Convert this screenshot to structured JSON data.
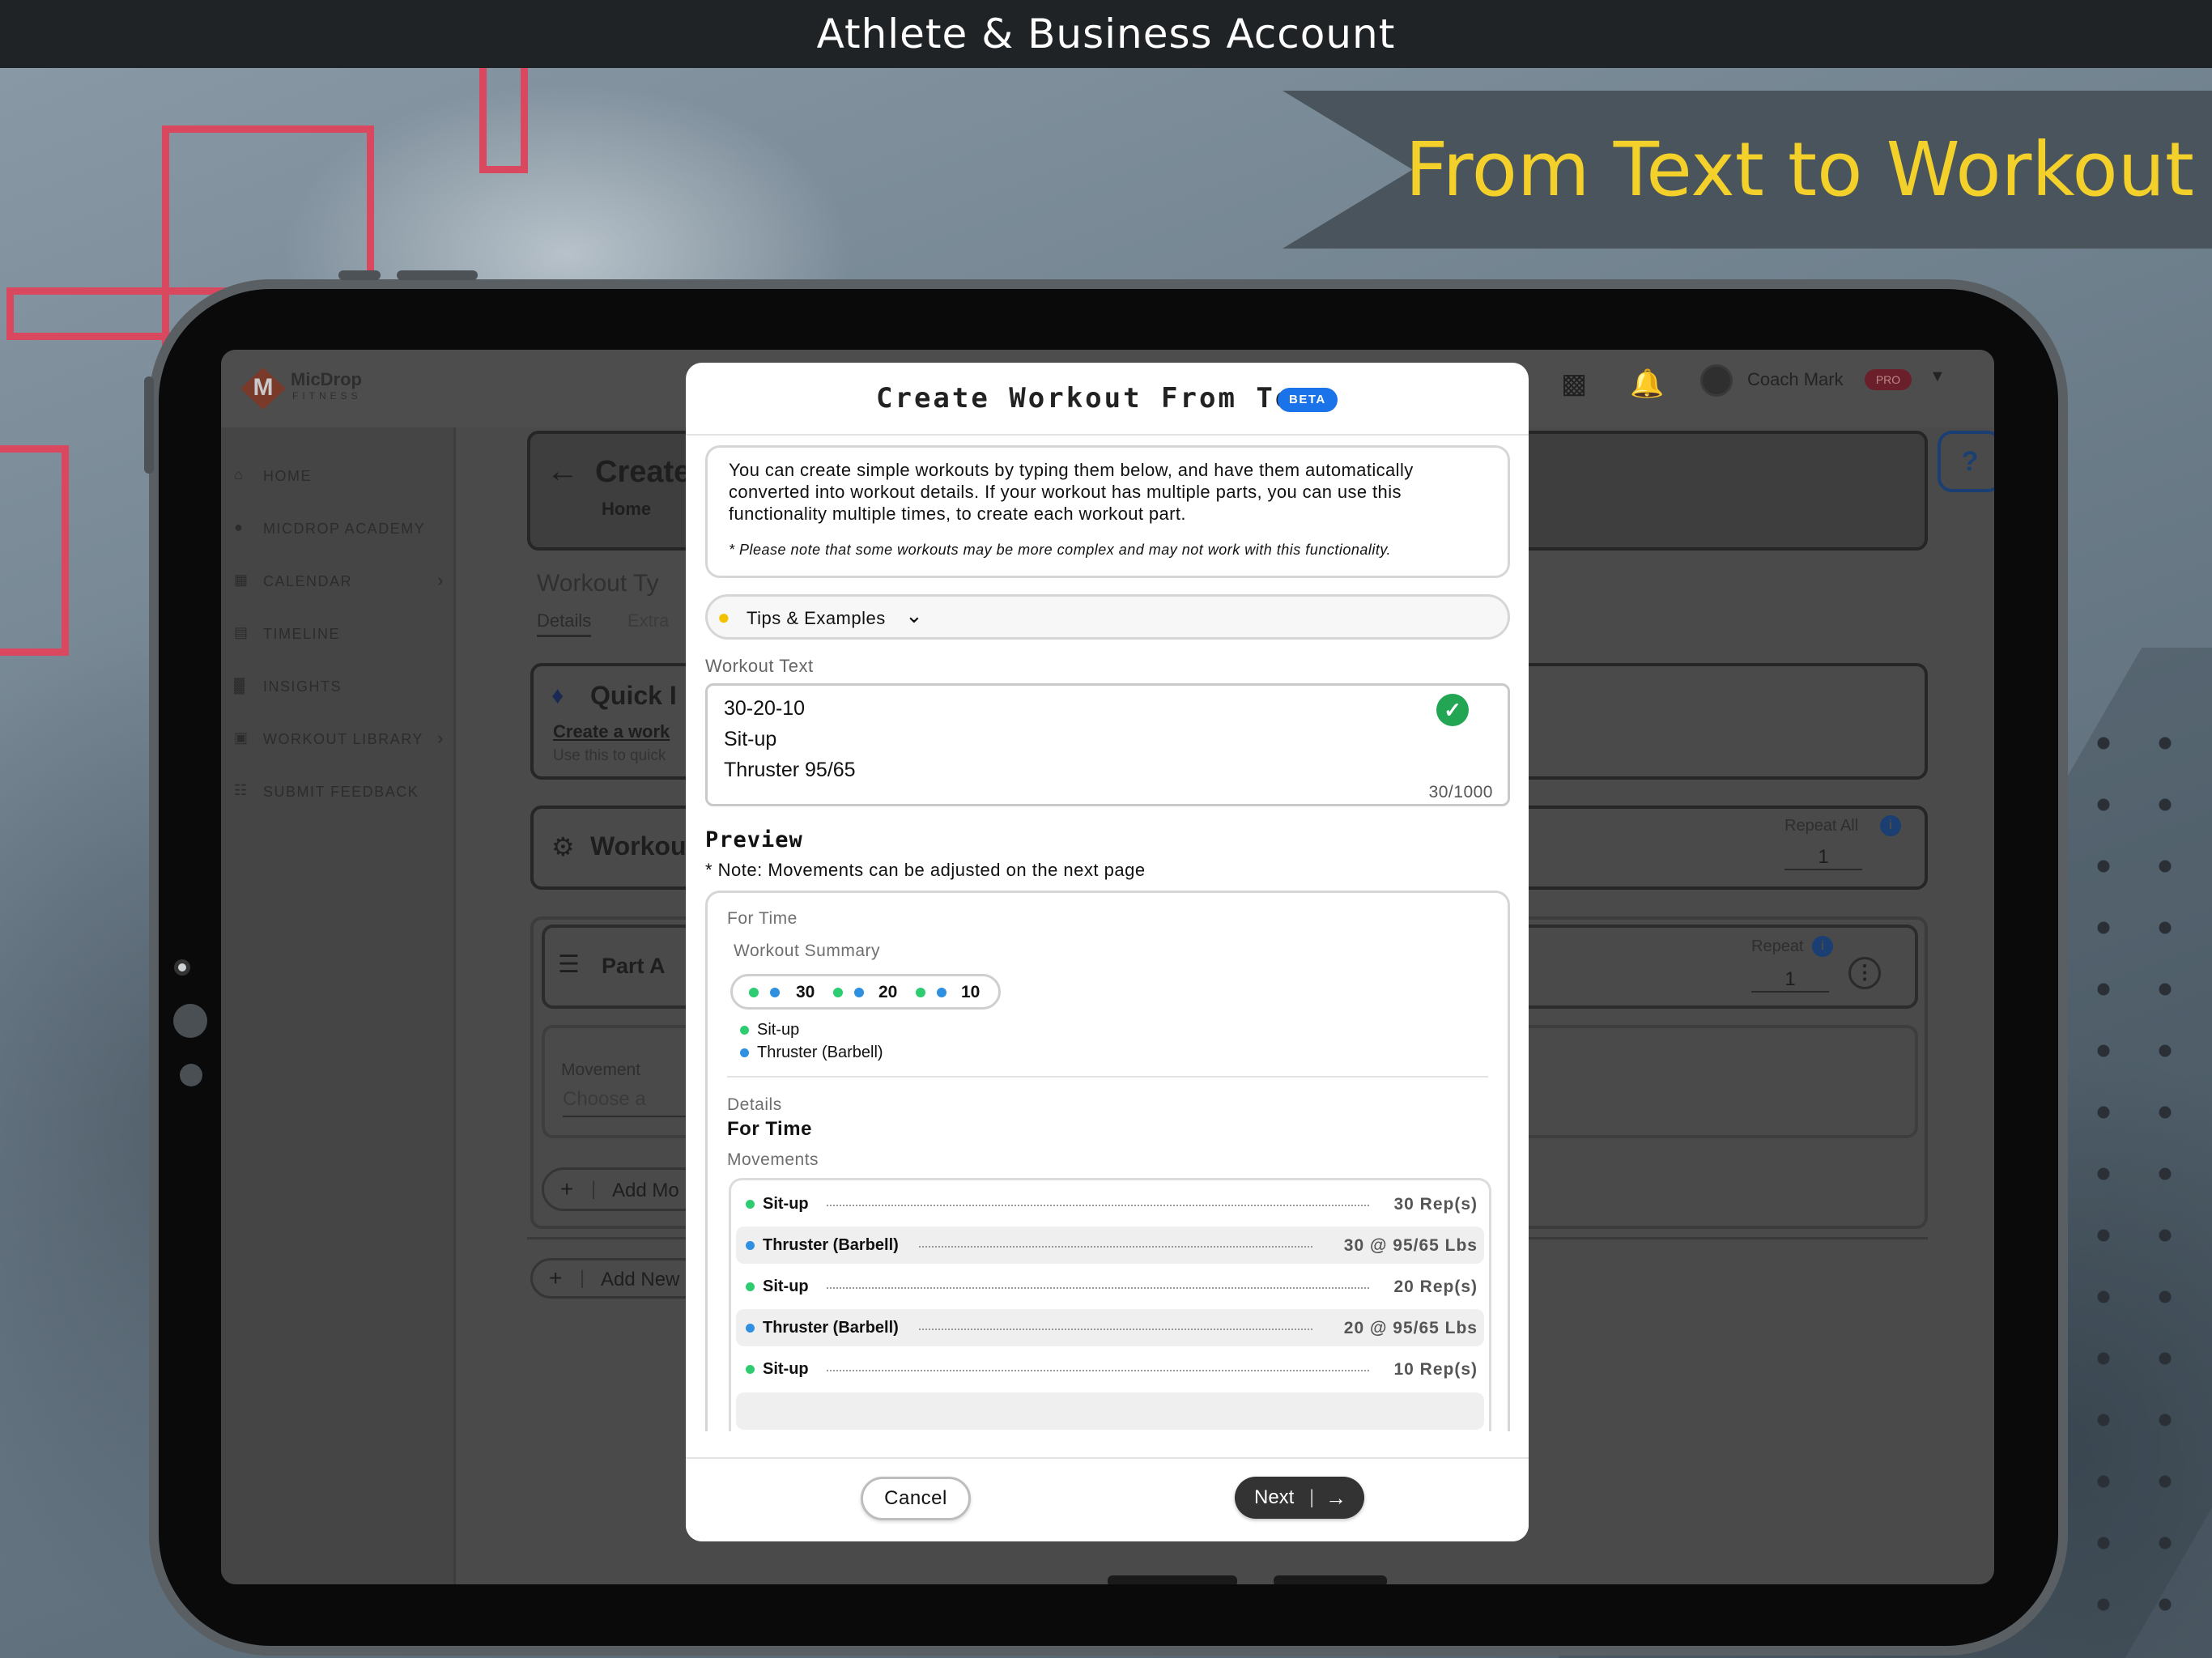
{
  "frame": {
    "top_title": "Athlete & Business Account",
    "banner": "From Text to Workout"
  },
  "app": {
    "logo_text": "MicDrop",
    "logo_sub": "FITNESS",
    "user_name": "Coach Mark",
    "user_badge": "PRO",
    "sidebar": [
      {
        "label": "HOME",
        "icon": "home-icon",
        "chevron": false
      },
      {
        "label": "MICDROP ACADEMY",
        "icon": "academy-icon",
        "chevron": false
      },
      {
        "label": "CALENDAR",
        "icon": "calendar-icon",
        "chevron": true
      },
      {
        "label": "TIMELINE",
        "icon": "timeline-icon",
        "chevron": false
      },
      {
        "label": "INSIGHTS",
        "icon": "insights-icon",
        "chevron": false
      },
      {
        "label": "WORKOUT LIBRARY",
        "icon": "library-icon",
        "chevron": true
      },
      {
        "label": "SUBMIT FEEDBACK",
        "icon": "feedback-icon",
        "chevron": false
      }
    ],
    "page_title_partial": "Create",
    "breadcrumb_home": "Home",
    "workout_type_partial": "Workout Ty",
    "tabs": [
      "Details",
      "Extra"
    ],
    "quick_partial": "Quick I",
    "create_link_partial": "Create a work",
    "use_this_partial": "Use this to quick",
    "workout_section_partial": "Workou",
    "repeat_all_label": "Repeat All",
    "repeat_all_value": "1",
    "part_label": "Part A",
    "repeat_label": "Repeat",
    "repeat_value": "1",
    "movement_label": "Movement",
    "movement_placeholder_partial": "Choose a",
    "add_mov_partial": "Add Mo",
    "add_new_partial": "Add New",
    "help_glyph": "?"
  },
  "modal": {
    "title": "Create Workout From Text",
    "beta": "BETA",
    "intro": "You can create simple workouts by typing them below, and have them automatically converted into workout details. If your workout has multiple parts, you can use this functionality multiple times, to create each workout part.",
    "note": "* Please note that some workouts may be more complex and may not work with this functionality.",
    "tips_label": "Tips & Examples",
    "workout_text_label": "Workout Text",
    "workout_text_lines": [
      "30-20-10",
      "Sit-up",
      "Thruster 95/65"
    ],
    "char_count": "30/1000",
    "preview_title": "Preview",
    "preview_note": "* Note: Movements can be adjusted on the next page",
    "for_time_small": "For Time",
    "summary_label": "Workout Summary",
    "summary_reps": [
      "30",
      "20",
      "10"
    ],
    "legend": [
      {
        "name": "Sit-up",
        "color": "#2ecc71"
      },
      {
        "name": "Thruster (Barbell)",
        "color": "#2f8fe0"
      }
    ],
    "details_label": "Details",
    "details_type": "For Time",
    "movements_label": "Movements",
    "movements": [
      {
        "name": "Sit-up",
        "value": "30 Rep(s)",
        "color": "#2ecc71"
      },
      {
        "name": "Thruster (Barbell)",
        "value": "30 @ 95/65 Lbs",
        "color": "#2f8fe0"
      },
      {
        "name": "Sit-up",
        "value": "20 Rep(s)",
        "color": "#2ecc71"
      },
      {
        "name": "Thruster (Barbell)",
        "value": "20 @ 95/65 Lbs",
        "color": "#2f8fe0"
      },
      {
        "name": "Sit-up",
        "value": "10 Rep(s)",
        "color": "#2ecc71"
      }
    ],
    "cancel_label": "Cancel",
    "next_label": "Next"
  }
}
